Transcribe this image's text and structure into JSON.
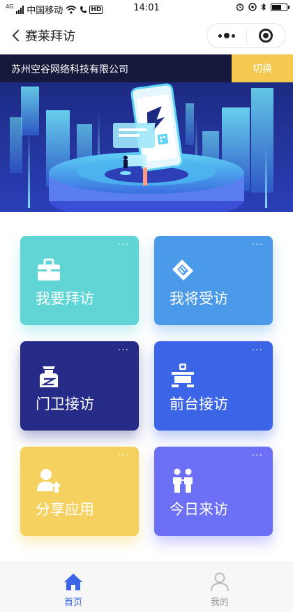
{
  "status_bar": {
    "network_type": "4G",
    "carrier": "中国移动",
    "hd_badge": "HD",
    "time": "14:01",
    "battery_level": 0.7
  },
  "nav": {
    "title": "赛莱拜访",
    "menu_icon": "more-dots-icon",
    "close_icon": "target-close-icon"
  },
  "banner": {
    "company_name": "苏州空谷网络科技有限公司",
    "switch_label": "切换",
    "strip_color": "#151a3d",
    "switch_color": "#f3c950"
  },
  "features": [
    {
      "label": "我要拜访",
      "icon": "briefcase-icon",
      "color": "#5fd5d6",
      "more": "···"
    },
    {
      "label": "我将受访",
      "icon": "handshake-icon",
      "color": "#4b9ae9",
      "more": "···"
    },
    {
      "label": "门卫接访",
      "icon": "guard-icon",
      "color": "#252b87",
      "more": "···"
    },
    {
      "label": "前台接访",
      "icon": "reception-desk-icon",
      "color": "#3b65e6",
      "more": "···"
    },
    {
      "label": "分享应用",
      "icon": "share-user-icon",
      "color": "#f5d160",
      "more": "···"
    },
    {
      "label": "今日来访",
      "icon": "visitors-icon",
      "color": "#6c70f4",
      "more": "···"
    }
  ],
  "tabs": [
    {
      "label": "首页",
      "icon": "home-icon",
      "active": true
    },
    {
      "label": "我的",
      "icon": "profile-icon",
      "active": false
    }
  ],
  "colors": {
    "accent": "#3b65e6",
    "inactive_tab": "#999999"
  }
}
